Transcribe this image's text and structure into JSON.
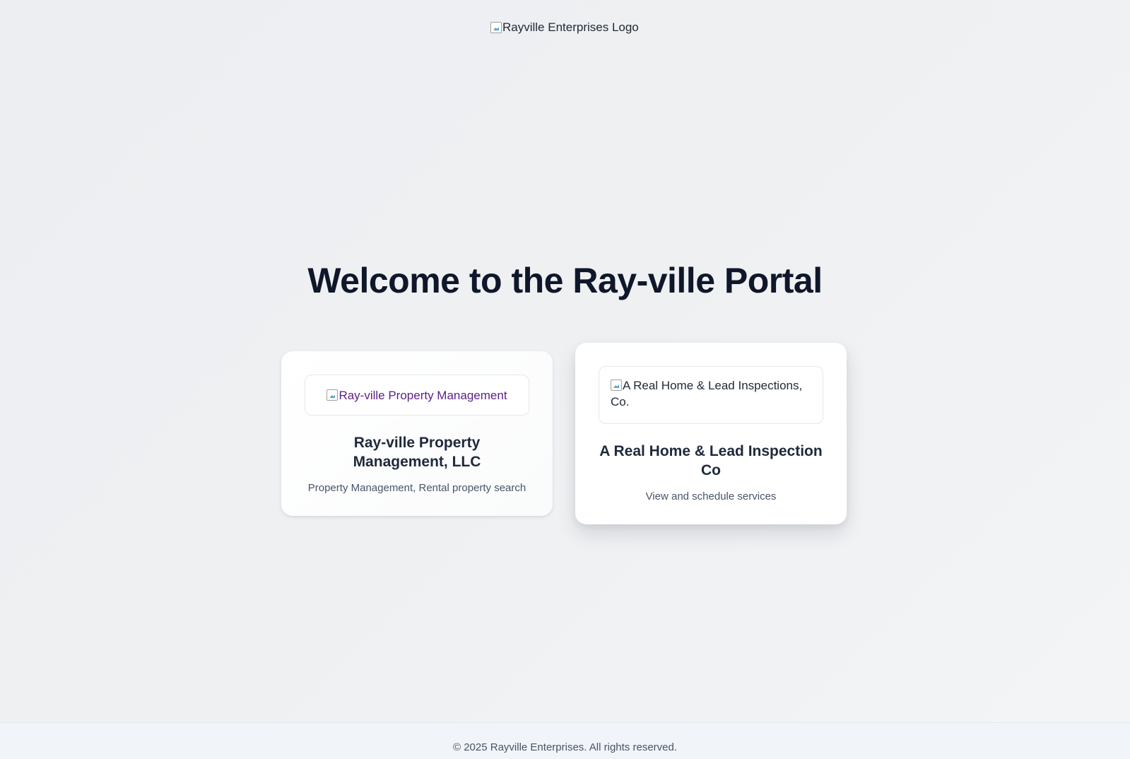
{
  "header": {
    "logo_alt": "Rayville Enterprises Logo"
  },
  "main": {
    "title": "Welcome to the Ray-ville Portal",
    "cards": [
      {
        "image_alt": "Ray-ville Property Management",
        "title": "Ray-ville Property Management, LLC",
        "description": "Property Management, Rental property search"
      },
      {
        "image_alt": "A Real Home & Lead Inspections, Co.",
        "title": "A Real Home & Lead Inspection Co",
        "description": "View and schedule services"
      }
    ]
  },
  "footer": {
    "copyright": "© 2025 Rayville Enterprises. All rights reserved."
  }
}
